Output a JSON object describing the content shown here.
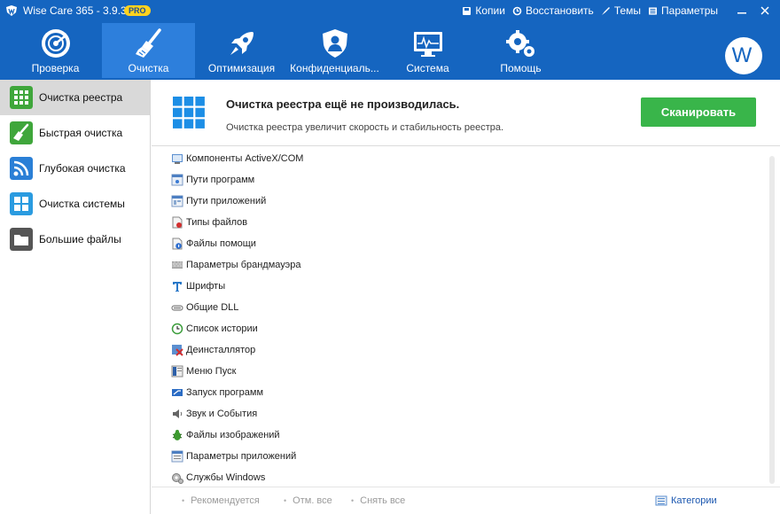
{
  "app": {
    "title": "Wise Care 365 - 3.9.3",
    "badge": "PRO"
  },
  "top_links": [
    {
      "label": "Копии",
      "icon": "backup-icon"
    },
    {
      "label": "Восстановить",
      "icon": "restore-icon"
    },
    {
      "label": "Темы",
      "icon": "themes-icon"
    },
    {
      "label": "Параметры",
      "icon": "settings-icon"
    }
  ],
  "nav": [
    {
      "label": "Проверка",
      "icon": "radar-icon"
    },
    {
      "label": "Очистка",
      "icon": "broom-icon",
      "active": true
    },
    {
      "label": "Оптимизация",
      "icon": "rocket-icon"
    },
    {
      "label": "Конфиденциаль...",
      "icon": "shield-user-icon"
    },
    {
      "label": "Система",
      "icon": "monitor-icon"
    },
    {
      "label": "Помощь",
      "icon": "gears-icon"
    }
  ],
  "avatar": {
    "letter": "W"
  },
  "sidebar": [
    {
      "label": "Очистка реестра",
      "icon": "registry-icon",
      "color": "#3fa63b",
      "active": true
    },
    {
      "label": "Быстрая очистка",
      "icon": "quick-clean-icon",
      "color": "#3fa63b"
    },
    {
      "label": "Глубокая очистка",
      "icon": "deep-clean-icon",
      "color": "#2a7fd6"
    },
    {
      "label": "Очистка системы",
      "icon": "windows-clean-icon",
      "color": "#2a9be0"
    },
    {
      "label": "Большие файлы",
      "icon": "large-files-icon",
      "color": "#555555"
    }
  ],
  "banner": {
    "title": "Очистка реестра ещё не производилась.",
    "subtitle": "Очистка реестра увеличит скорость и стабильность реестра.",
    "scan_label": "Сканировать"
  },
  "items": [
    {
      "label": "Компоненты ActiveX/COM",
      "icon": "activex-icon"
    },
    {
      "label": "Пути программ",
      "icon": "program-paths-icon"
    },
    {
      "label": "Пути приложений",
      "icon": "app-paths-icon"
    },
    {
      "label": "Типы файлов",
      "icon": "file-types-icon"
    },
    {
      "label": "Файлы помощи",
      "icon": "help-files-icon"
    },
    {
      "label": "Параметры брандмауэра",
      "icon": "firewall-icon"
    },
    {
      "label": "Шрифты",
      "icon": "fonts-icon"
    },
    {
      "label": "Общие DLL",
      "icon": "shared-dll-icon"
    },
    {
      "label": "Список истории",
      "icon": "history-icon"
    },
    {
      "label": "Деинсталлятор",
      "icon": "uninstaller-icon"
    },
    {
      "label": "Меню Пуск",
      "icon": "start-menu-icon"
    },
    {
      "label": "Запуск программ",
      "icon": "startup-icon"
    },
    {
      "label": "Звук и События",
      "icon": "sound-icon"
    },
    {
      "label": "Файлы изображений",
      "icon": "image-files-icon"
    },
    {
      "label": "Параметры приложений",
      "icon": "app-settings-icon"
    },
    {
      "label": "Службы Windows",
      "icon": "services-icon"
    }
  ],
  "footer": {
    "recommended": "Рекомендуется",
    "select_all": "Отм. все",
    "deselect_all": "Снять все",
    "categories": "Категории"
  },
  "colors": {
    "header": "#1565c0",
    "active_tab": "#2d7fdc",
    "scan_button": "#39b54a",
    "pro_badge": "#ffd21f"
  }
}
